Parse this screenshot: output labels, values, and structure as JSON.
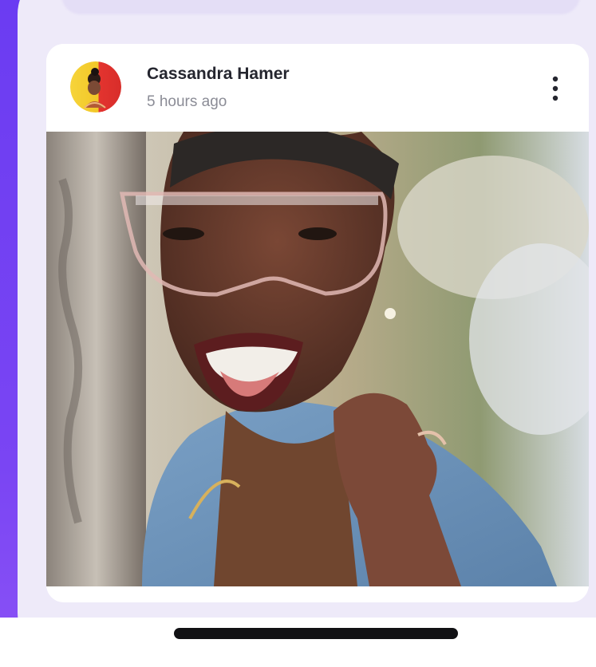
{
  "post": {
    "author": "Cassandra Hamer",
    "timestamp": "5 hours ago",
    "avatar_icon": "profile-avatar-icon",
    "menu_icon": "more-vertical-icon"
  },
  "theme": {
    "background": "#6b3cf2",
    "card": "#ffffff",
    "text": "#25262f",
    "muted": "#8b8c96"
  }
}
